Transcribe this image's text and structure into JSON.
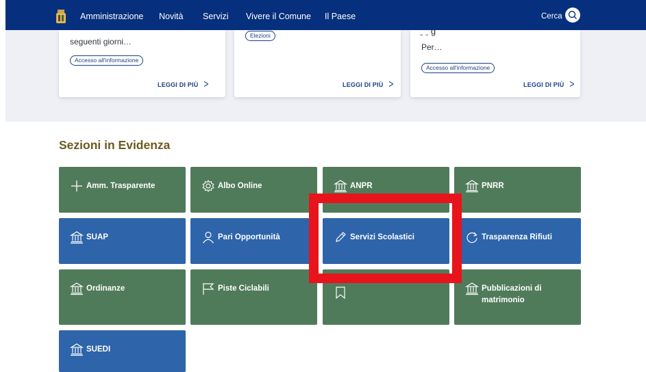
{
  "nav": {
    "items": [
      "Amministrazione",
      "Novità",
      "Servizi",
      "Vivere il Comune",
      "Il Paese"
    ],
    "search_label": "Cerca"
  },
  "cards": [
    {
      "text": "seguenti giorni…",
      "chip": "Accesso all'informazione",
      "read_more": "LEGGI DI PIÙ"
    },
    {
      "chip": "Elezioni",
      "read_more": "LEGGI DI PIÙ"
    },
    {
      "text": "Per…",
      "chip": "Accesso all'informazione",
      "read_more": "LEGGI DI PIÙ"
    }
  ],
  "section": {
    "title": "Sezioni in Evidenza",
    "tiles": [
      {
        "label": "Amm. Trasparente",
        "icon": "plus-icon",
        "color": "#507b5a"
      },
      {
        "label": "Albo Online",
        "icon": "gear-icon",
        "color": "#507b5a"
      },
      {
        "label": "ANPR",
        "icon": "bank-icon",
        "color": "#507b5a"
      },
      {
        "label": "PNRR",
        "icon": "bank-icon",
        "color": "#507b5a"
      },
      {
        "label": "SUAP",
        "icon": "bank-icon",
        "color": "#2e64aa"
      },
      {
        "label": "Pari Opportunità",
        "icon": "user-icon",
        "color": "#2e64aa"
      },
      {
        "label": "Servizi Scolastici",
        "icon": "pencil-icon",
        "color": "#2e64aa"
      },
      {
        "label": "Trasparenza Rifiuti",
        "icon": "refresh-icon",
        "color": "#2e64aa"
      },
      {
        "label": "Ordinanze",
        "icon": "bank-icon",
        "color": "#507b5a"
      },
      {
        "label": "Piste Ciclabili",
        "icon": "flag-icon",
        "color": "#507b5a"
      },
      {
        "label": "",
        "icon": "bookmark-icon",
        "color": "#507b5a"
      },
      {
        "label": "Pubblicazioni di matrimonio",
        "icon": "bank-icon",
        "color": "#507b5a"
      },
      {
        "label": "SUEDI",
        "icon": "bank-icon",
        "color": "#2e64aa"
      }
    ]
  },
  "colors": {
    "navbar": "#06307d",
    "tile_green": "#507b5a",
    "tile_blue": "#2e64aa",
    "section_title": "#6b5a1f",
    "highlight": "#e8141b"
  }
}
